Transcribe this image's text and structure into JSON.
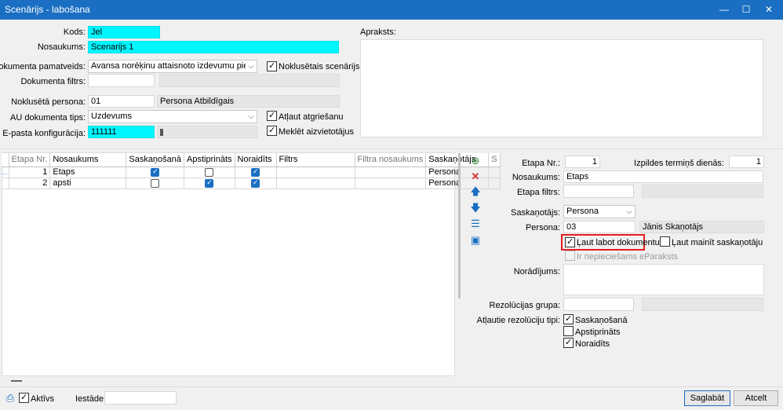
{
  "window": {
    "title": "Scenārijs - labošana",
    "min": "—",
    "max": "☐",
    "close": "✕"
  },
  "header": {
    "kods_label": "Kods:",
    "kods_value": "Jel",
    "nosaukums_label": "Nosaukums:",
    "nosaukums_value": "Scenarijs 1",
    "dok_pamat_label": "Dokumenta pamatveids:",
    "dok_pamat_value": "Avansa norēķinu attaisnoto izdevumu pieteikumu komplekts",
    "noklusetais_label": "Noklusētais scenārijs",
    "dok_filtrs_label": "Dokumenta filtrs:",
    "nokl_persona_label": "Noklusētā persona:",
    "nokl_persona_code": "01",
    "nokl_persona_name": "Persona Atbildīgais",
    "au_tips_label": "AU dokumenta tips:",
    "au_tips_value": "Uzdevums",
    "atlaut_atgriesanu_label": "Atļaut atgriešanu",
    "epasta_label": "E-pasta konfigurācija:",
    "epasta_value": "111111",
    "meklet_label": "Meklēt aizvietotājus",
    "apraksts_label": "Apraksts:"
  },
  "grid": {
    "columns": [
      "Etapa Nr.",
      "Nosaukums",
      "Saskaņošanā",
      "Apstiprināts",
      "Noraidīts",
      "Filtrs",
      "Filtra nosaukums",
      "Saskaņotājs",
      "S"
    ],
    "rows": [
      {
        "nr": "1",
        "nosaukums": "Etaps",
        "saskanosana": true,
        "apstiprinats": false,
        "noraidits": true,
        "filtrs": "",
        "filtra_nosaukums": "",
        "saskanotajs": "Persona"
      },
      {
        "nr": "2",
        "nosaukums": "apsti",
        "saskanosana": false,
        "apstiprinats": true,
        "noraidits": true,
        "filtrs": "",
        "filtra_nosaukums": "",
        "saskanotajs": "Persona"
      }
    ]
  },
  "stage": {
    "etapa_nr_label": "Etapa Nr.:",
    "etapa_nr_value": "1",
    "termins_label": "Izpildes termiņš dienās:",
    "termins_value": "1",
    "nosaukums_label": "Nosaukums:",
    "nosaukums_value": "Etaps",
    "filtrs_label": "Etapa filtrs:",
    "saskanotajs_label": "Saskaņotājs:",
    "saskanotajs_value": "Persona",
    "persona_label": "Persona:",
    "persona_code": "03",
    "persona_name": "Jānis Skaņotājs",
    "laut_labot_label": "Ļaut labot dokumentu",
    "laut_mainit_label": "Ļaut mainīt saskaņotāju",
    "eparaksts_label": "Ir nepieciešams eParaksts",
    "noradijums_label": "Norādījums:",
    "rez_grupa_label": "Rezolūcijas grupa:",
    "atlautie_label": "Atļautie rezolūciju tipi:",
    "tipi": [
      "Saskaņošanā",
      "Apstiprināts",
      "Noraidīts"
    ]
  },
  "footer": {
    "aktivs_label": "Aktīvs",
    "iestade_label": "Iestāde:",
    "saglabat": "Saglabāt",
    "atcelt": "Atcelt"
  }
}
